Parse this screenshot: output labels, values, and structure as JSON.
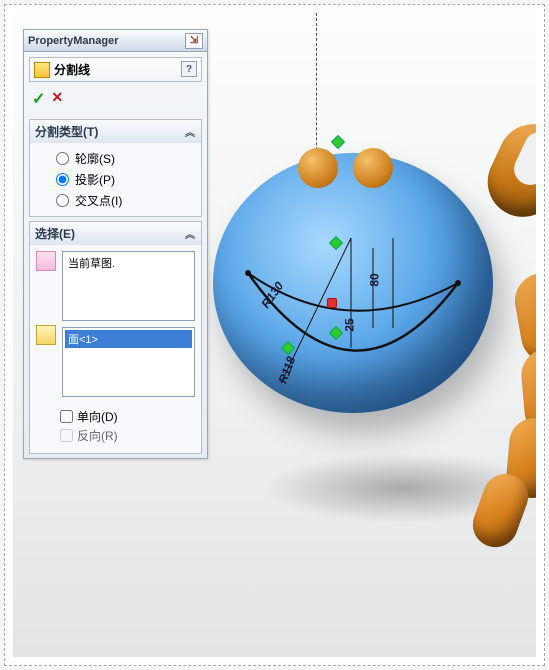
{
  "header": {
    "title": "PropertyManager"
  },
  "feature": {
    "title": "分割线",
    "help": "?"
  },
  "confirm": {
    "ok": "✓",
    "cancel": "✕"
  },
  "group_type": {
    "title": "分割类型(T)",
    "options": {
      "outline": "轮廓(S)",
      "projection": "投影(P)",
      "intersection": "交叉点(I)"
    },
    "selected": "projection"
  },
  "group_select": {
    "title": "选择(E)",
    "sketch_list": [
      "当前草图."
    ],
    "face_list": [
      "面<1>"
    ],
    "checks": {
      "single_dir": "单向(D)",
      "reverse": "反向(R)"
    }
  },
  "dims": {
    "r130": "R130",
    "r118": "R118",
    "d25": "25",
    "d80": "80"
  }
}
